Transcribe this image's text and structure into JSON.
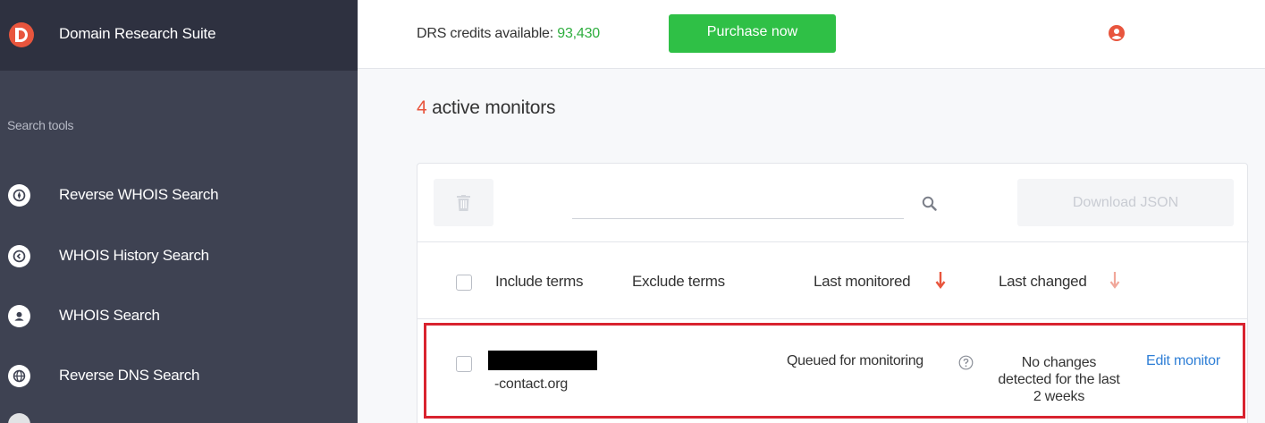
{
  "app": {
    "title": "Domain Research Suite"
  },
  "sidebar": {
    "section_label": "Search tools",
    "items": [
      {
        "label": "Reverse WHOIS Search",
        "icon": "compass-icon"
      },
      {
        "label": "WHOIS History Search",
        "icon": "history-icon"
      },
      {
        "label": "WHOIS Search",
        "icon": "person-icon"
      },
      {
        "label": "Reverse DNS Search",
        "icon": "globe-icon"
      }
    ]
  },
  "topbar": {
    "credits_label": "DRS credits available: ",
    "credits_value": "93,430",
    "purchase_label": "Purchase now",
    "user_icon": "user-icon"
  },
  "main": {
    "active_count": "4",
    "active_label": " active monitors",
    "toolbar": {
      "search_placeholder": "",
      "download_label": "Download JSON"
    },
    "columns": {
      "include": "Include terms",
      "exclude": "Exclude terms",
      "last_monitored": "Last monitored",
      "last_changed": "Last changed"
    },
    "rows": [
      {
        "domain": "-contact.org",
        "status": "Queued for monitoring",
        "changes": "No changes detected for the last 2 weeks",
        "action": "Edit monitor"
      }
    ]
  },
  "colors": {
    "sidebar_bg": "#3e4252",
    "sidebar_header_bg": "#2e3140",
    "accent_green": "#2fc046",
    "accent_red": "#e8553d",
    "link_blue": "#2f7fd6",
    "highlight_red": "#d9232f"
  }
}
